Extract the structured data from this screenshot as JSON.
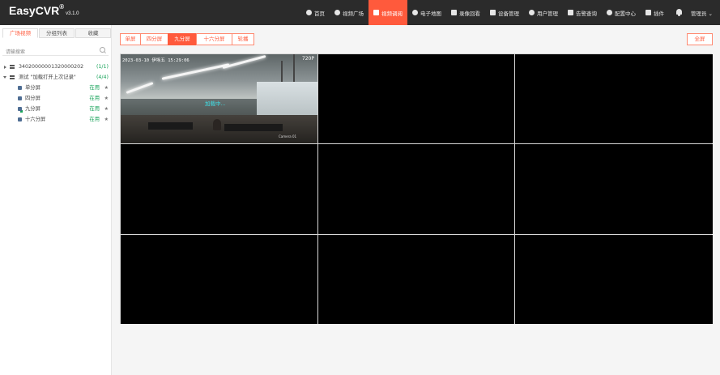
{
  "app": {
    "name": "EasyCVR",
    "registered": "®",
    "version": "v3.1.0"
  },
  "nav": {
    "items": [
      {
        "label": "首页",
        "icon": "home-icon",
        "active": false
      },
      {
        "label": "视频广场",
        "icon": "play-circle-icon",
        "active": false
      },
      {
        "label": "视频调阅",
        "icon": "video-grid-icon",
        "active": true
      },
      {
        "label": "电子地图",
        "icon": "map-pin-icon",
        "active": false
      },
      {
        "label": "录像回看",
        "icon": "camera-icon",
        "active": false
      },
      {
        "label": "设备管理",
        "icon": "grid-icon",
        "active": false
      },
      {
        "label": "用户管理",
        "icon": "user-icon",
        "active": false
      },
      {
        "label": "告警查询",
        "icon": "alarm-icon",
        "active": false
      },
      {
        "label": "配置中心",
        "icon": "gear-icon",
        "active": false
      },
      {
        "label": "插件",
        "icon": "puzzle-icon",
        "active": false
      }
    ],
    "user_label": "管理员 ⌄"
  },
  "sidebar": {
    "tabs": [
      "广场视频",
      "分组列表",
      "收藏"
    ],
    "active_tab": 0,
    "search_placeholder": "请输搜索",
    "tree": [
      {
        "label": "34020000001320000202",
        "count": "(1/1)",
        "expanded": false
      },
      {
        "label": "测试 \"加载打开上次记录\"",
        "count": "(4/4)",
        "expanded": true
      }
    ],
    "leaves": [
      {
        "label": "单分屏",
        "status": "在用"
      },
      {
        "label": "四分屏",
        "status": "在用"
      },
      {
        "label": "九分屏",
        "status": "在用"
      },
      {
        "label": "十六分屏",
        "status": "在用"
      }
    ]
  },
  "toolbar": {
    "splits": [
      "单屏",
      "四分屏",
      "九分屏",
      "十六分屏",
      "轮播"
    ],
    "active_split": 2,
    "fullscreen": "全屏"
  },
  "player": {
    "cells": 9,
    "first_cell": {
      "timestamp": "2023-03-10 伊埃五 15:29:06",
      "resolution": "720P",
      "loading_text": "加载中...",
      "caption": "Camera 01"
    }
  },
  "colors": {
    "accent": "#ff5a3c",
    "topbar": "#2b2b2b",
    "online": "#18a35a"
  }
}
